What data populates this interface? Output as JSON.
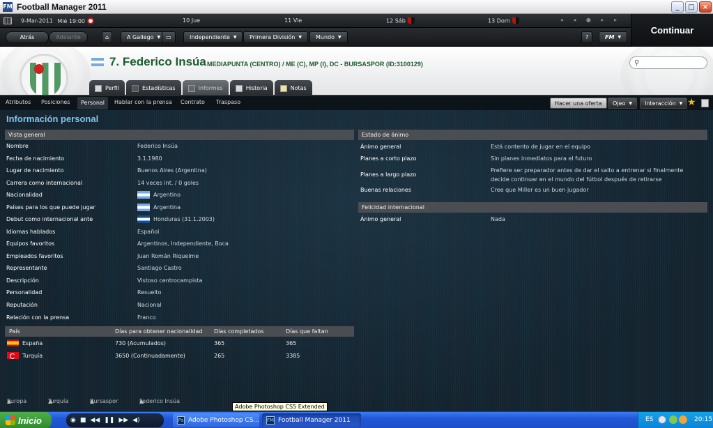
{
  "window": {
    "title": "Football Manager 2011"
  },
  "calendar": {
    "current": "9-Mar-2011",
    "current_day": "Mié 19:00",
    "days": [
      "10 Jue",
      "11 Vie",
      "12 Sáb",
      "13 Dom"
    ]
  },
  "nav": {
    "back": "Atrás",
    "forward": "Adelante",
    "manager": "A Gallego",
    "club": "Independiente",
    "league": "Primera División",
    "world": "Mundo",
    "help": "?",
    "fm_menu": "FM",
    "continue": "Continuar"
  },
  "player": {
    "number_name": "7. Federico Insúa",
    "subtitle": "MEDIAPUNTA (CENTRO) / ME (C), MP (I), DC - BURSASPOR (ID:3100129)"
  },
  "tabs": [
    "Perfil",
    "Estadísticas",
    "Informes",
    "Historia",
    "Notas"
  ],
  "subtabs": [
    "Atributos",
    "Posiciones",
    "Personal",
    "Hablar con la prensa",
    "Contrato",
    "Traspaso"
  ],
  "actions": {
    "offer": "Hacer una oferta",
    "scout": "Ojeo",
    "interaction": "Interacción"
  },
  "section_title": "Información personal",
  "overview": {
    "header": "Vista general",
    "rows": [
      {
        "label": "Nombre",
        "value": "Federico Insúa"
      },
      {
        "label": "Fecha de nacimiento",
        "value": "3.1.1980"
      },
      {
        "label": "Lugar de nacimiento",
        "value": "Buenos Aires (Argentina)"
      },
      {
        "label": "Carrera como internacional",
        "value": "14 veces int. / 0 goles"
      },
      {
        "label": "Nacionalidad",
        "value": "Argentino",
        "flag": "arg"
      },
      {
        "label": "Países para los que puede jugar",
        "value": "Argentina",
        "flag": "arg"
      },
      {
        "label": "Debut como internacional ante",
        "value": "Honduras (31.1.2003)",
        "flag": "hon"
      },
      {
        "label": "Idiomas hablados",
        "value": "Español"
      },
      {
        "label": "Equipos favoritos",
        "value": "Argentinos, Independiente, Boca"
      },
      {
        "label": "Empleados favoritos",
        "value": "Juan Román Riquelme"
      },
      {
        "label": "Representante",
        "value": "Santiago Castro"
      },
      {
        "label": "Descripción",
        "value": "Vistoso centrocampista"
      },
      {
        "label": "Personalidad",
        "value": "Resuelto"
      },
      {
        "label": "Reputación",
        "value": "Nacional"
      },
      {
        "label": "Relación con la prensa",
        "value": "Franco"
      }
    ]
  },
  "nationality_table": {
    "headers": [
      "País",
      "Días para obtener nacionalidad",
      "Días completados",
      "Días que faltan"
    ],
    "rows": [
      {
        "country": "España",
        "flag": "esp",
        "days_needed": "730 (Acumulados)",
        "completed": "365",
        "remaining": "365"
      },
      {
        "country": "Turquía",
        "flag": "tur",
        "days_needed": "3650 (Continuadamente)",
        "completed": "265",
        "remaining": "3385"
      }
    ]
  },
  "mood": {
    "header": "Estado de ánimo",
    "rows": [
      {
        "label": "Ánimo general",
        "value": "Está contento de jugar en el equipo"
      },
      {
        "label": "Planes a corto plazo",
        "value": "Sin planes inmediatos para el futuro"
      },
      {
        "label": "Planes a largo plazo",
        "value": "Prefiere ser preparador antes de dar el salto a entrenar si finalmente",
        "value2": "decide continuar en el mundo del fútbol después de retirarse"
      },
      {
        "label": "Buenas relaciones",
        "value": "Cree que Miller es un buen jugador"
      }
    ]
  },
  "intl_happiness": {
    "header": "Felicidad internacional",
    "rows": [
      {
        "label": "Ánimo general",
        "value": "Nada"
      }
    ]
  },
  "breadcrumbs": [
    "Europa",
    "Turquía",
    "Bursaspor",
    "Federico Insúa"
  ],
  "tooltip": "Adobe Photoshop CS5 Extended",
  "taskbar": {
    "start": "Inicio",
    "items": [
      "Adobe Photoshop CS...",
      "Football Manager 2011"
    ],
    "lang": "ES",
    "clock": "20:15"
  }
}
